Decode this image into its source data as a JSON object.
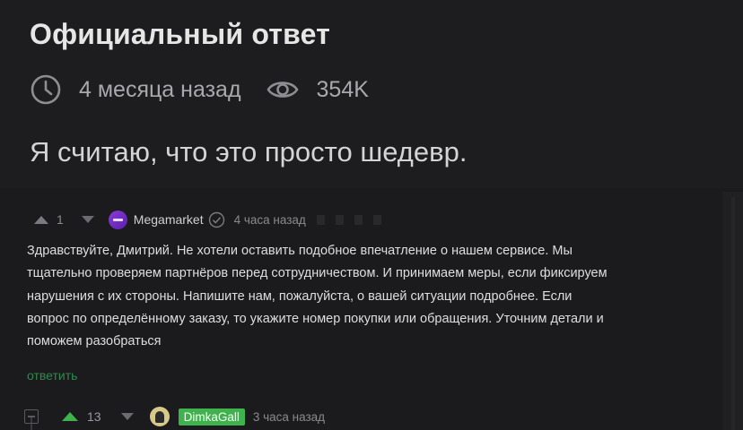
{
  "post": {
    "title": "Официальный ответ",
    "time_ago": "4 месяца назад",
    "views": "354K",
    "answer_text": "Я считаю, что это просто шедевр."
  },
  "comment": {
    "score": "1",
    "author": "Megamarket",
    "time_ago": "4 часа назад",
    "lines": [
      "Здравствуйте, Дмитрий. Не хотели оставить подобное впечатление о нашем сервисе. Мы",
      "тщательно проверяем партнёров перед сотрудничеством. И принимаем меры, если фиксируем",
      "нарушения с их стороны. Напишите нам, пожалуйста, о вашей ситуации подробнее. Если",
      "вопрос по определённому заказу, то укажите номер покупки или обращения. Уточним детали и",
      "поможем разобраться"
    ],
    "reply_label": "ответить"
  },
  "reply": {
    "score": "13",
    "author": "DimkaGall",
    "time_ago": "3 часа назад"
  },
  "colors": {
    "background": "#1d1d1f",
    "accent_green": "#3fb24d",
    "link_green": "#2f8a4d",
    "brand_purple": "#8b3bd6"
  },
  "icons": [
    "clock-icon",
    "eye-icon",
    "upvote-icon",
    "downvote-icon",
    "verified-icon",
    "collapse-icon"
  ]
}
